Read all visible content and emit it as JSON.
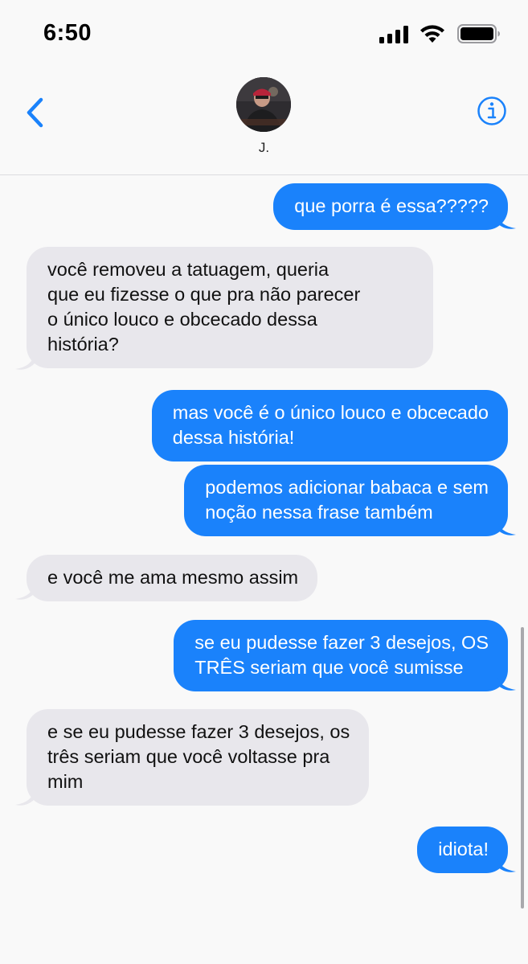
{
  "status_bar": {
    "time": "6:50"
  },
  "header": {
    "contact_name": "J."
  },
  "colors": {
    "accent": "#1a82fb",
    "sent_bubble": "#1a82fb",
    "received_bubble": "#e8e7ec"
  },
  "icons": {
    "back": "chevron-left-icon",
    "info": "info-icon",
    "signal": "cellular-signal-icon",
    "wifi": "wifi-icon",
    "battery": "battery-icon"
  },
  "messages": [
    {
      "direction": "sent",
      "text": "que porra é essa?????"
    },
    {
      "direction": "received",
      "text": "você removeu a tatuagem, queria\nque eu fizesse o que pra não parecer\no único louco e obcecado dessa\nhistória?"
    },
    {
      "direction": "sent",
      "text": "mas você é o único louco e obcecado\ndessa história!"
    },
    {
      "direction": "sent",
      "text": "podemos adicionar babaca e sem\nnoção nessa frase também"
    },
    {
      "direction": "received",
      "text": "e você me ama mesmo assim"
    },
    {
      "direction": "sent",
      "text": "se eu pudesse fazer 3 desejos, OS\nTRÊS seriam que você sumisse"
    },
    {
      "direction": "received",
      "text": "e se eu pudesse fazer 3 desejos, os\ntrês seriam que você voltasse pra\nmim"
    },
    {
      "direction": "sent",
      "text": "idiota!"
    }
  ]
}
